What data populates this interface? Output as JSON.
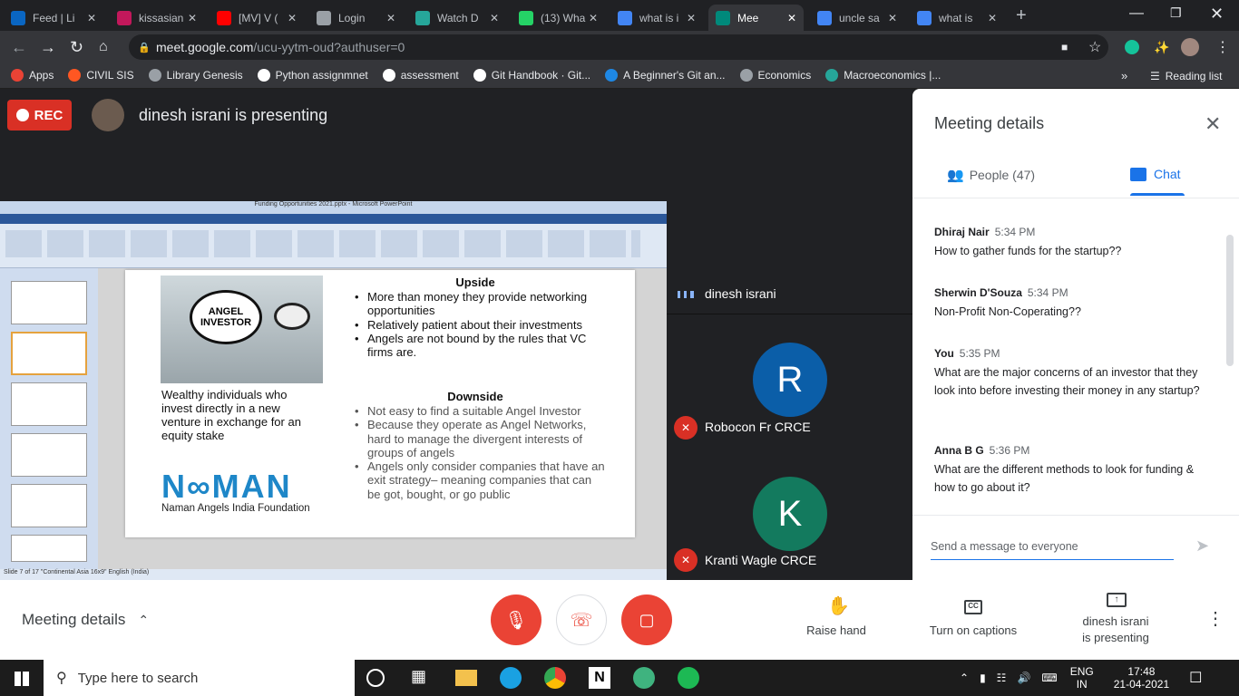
{
  "browser": {
    "tabs": [
      {
        "label": "Feed | Li",
        "color": "#0a66c2"
      },
      {
        "label": "kissasian",
        "color": "#c2185b"
      },
      {
        "label": "[MV] V (",
        "color": "#ff0000"
      },
      {
        "label": "Login",
        "color": "#9aa0a6"
      },
      {
        "label": "Watch D",
        "color": "#26a69a"
      },
      {
        "label": "(13) Wha",
        "color": "#25d366"
      },
      {
        "label": "what is i",
        "color": "#4285f4"
      },
      {
        "label": "Mee",
        "color": "#00897b"
      },
      {
        "label": "uncle sa",
        "color": "#4285f4"
      },
      {
        "label": "what is",
        "color": "#4285f4"
      }
    ],
    "url_host": "meet.google.com",
    "url_path": "/ucu-yytm-oud?authuser=0",
    "bookmarks": [
      "Apps",
      "CIVIL SIS",
      "Library Genesis",
      "Python assignmnet",
      "assessment",
      "Git Handbook · Git...",
      "A Beginner's Git an...",
      "Economics",
      "Macroeconomics |..."
    ],
    "reading_list": "Reading list"
  },
  "meet": {
    "rec_label": "REC",
    "presenting_text": "dinesh israni is presenting",
    "participants": [
      {
        "name": "dinesh israni",
        "initial": ""
      },
      {
        "name": "Robocon Fr CRCE",
        "initial": "R",
        "color": "#0b5ea8"
      },
      {
        "name": "Kranti Wagle CRCE",
        "initial": "K",
        "color": "#137a5e"
      }
    ]
  },
  "slide": {
    "ppt_title": "Funding Opportunities 2021.pptx - Microsoft PowerPoint",
    "ppt_status": "Slide 7 of 17   \"Continental Asia 16x9\"   English (India)",
    "bubble_text": "ANGEL INVESTOR",
    "left_text": "Wealthy individuals who invest directly in a new venture in exchange for an equity stake",
    "logo": "N̲AMAN",
    "logo_sub": "Naman Angels India Foundation",
    "upside_title": "Upside",
    "upside": [
      "More than money they provide networking opportunities",
      "Relatively patient about their investments",
      "Angels are not bound by the rules that VC firms are."
    ],
    "downside_title": "Downside",
    "downside": [
      "Not easy to find a suitable Angel Investor",
      "Because they operate as Angel Networks, hard to manage the divergent interests of groups of angels",
      "Angels only consider companies that have an exit strategy– meaning companies that can be got, bought, or go public"
    ]
  },
  "panel": {
    "title": "Meeting details",
    "people_tab": "People (47)",
    "chat_tab": "Chat",
    "messages": [
      {
        "who": "Dhiraj Nair",
        "time": "5:34 PM",
        "text": "How to gather funds for the startup??"
      },
      {
        "who": "Sherwin D'Souza",
        "time": "5:34 PM",
        "text": "Non-Profit Non-Coperating??"
      },
      {
        "who": "You",
        "time": "5:35 PM",
        "text": "What are the major concerns of an investor that they look into before investing their money in any startup?"
      },
      {
        "who": "Anna B G",
        "time": "5:36 PM",
        "text": "What are the different methods to look for funding & how to go about it?"
      }
    ],
    "composer_placeholder": "Send a message to everyone"
  },
  "controls": {
    "meeting_details": "Meeting details",
    "raise_hand": "Raise hand",
    "captions": "Turn on captions",
    "presenting_line1": "dinesh israni",
    "presenting_line2": "is presenting"
  },
  "taskbar": {
    "search_placeholder": "Type here to search",
    "lang1": "ENG",
    "lang2": "IN",
    "time": "17:48",
    "date": "21-04-2021"
  }
}
